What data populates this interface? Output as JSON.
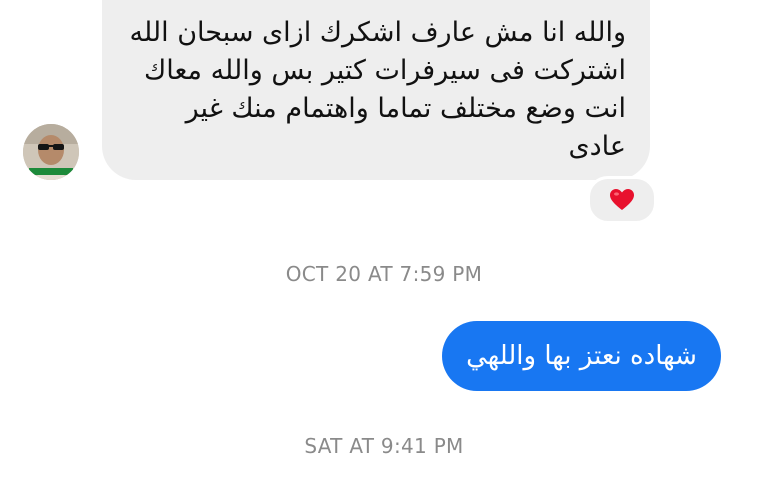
{
  "conversation": {
    "incoming_message": {
      "lines": [
        "والله انا مش عارف اشكرك ازاى سبحان الله",
        "اشتركت فى سيرفرات كتير بس والله معاك",
        "انت وضع مختلف تماما واهتمام منك غير",
        "عادى"
      ],
      "reaction": "heart-emoji"
    },
    "timestamp_1": "OCT 20 AT 7:59 PM",
    "outgoing_message": "شهاده نعتز بها واللهي",
    "timestamp_2": "SAT AT 9:41 PM"
  },
  "colors": {
    "incoming_bubble": "#eeeeee",
    "outgoing_bubble": "#1877f2",
    "timestamp": "#8a8a8a",
    "heart": "#e8112d"
  }
}
